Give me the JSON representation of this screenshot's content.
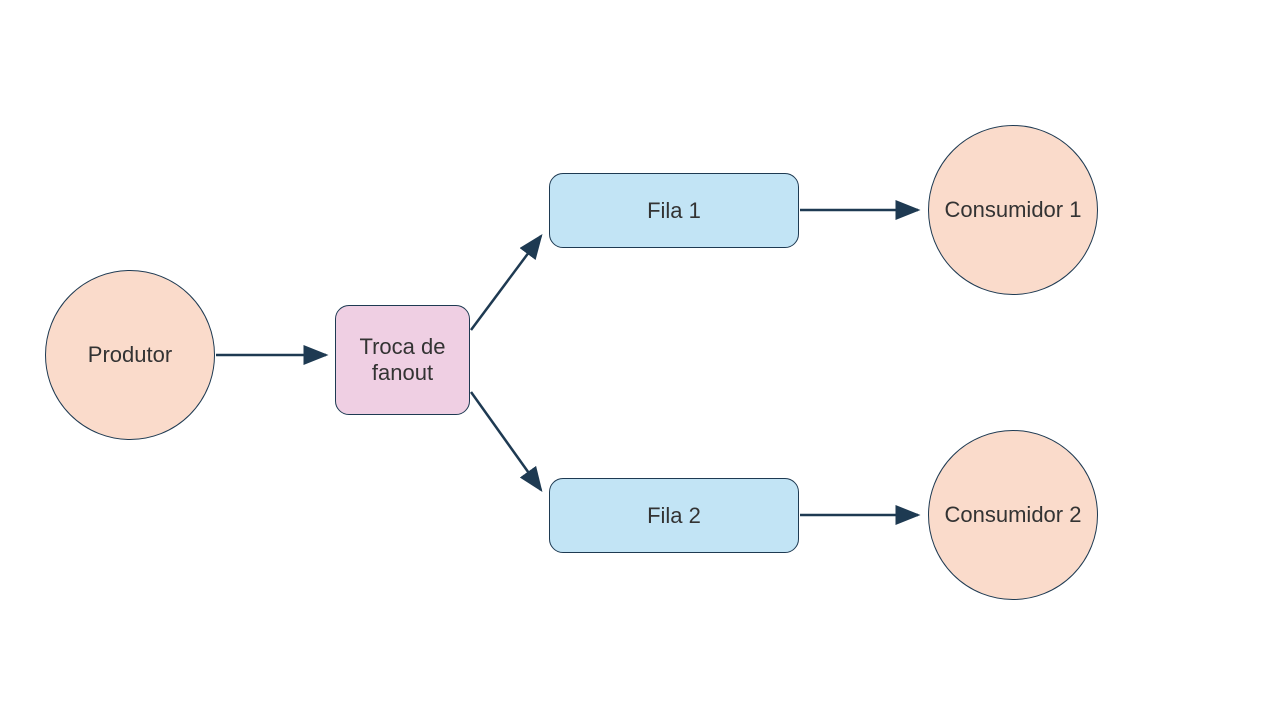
{
  "nodes": {
    "producer": {
      "label": "Produtor"
    },
    "exchange": {
      "label": "Troca de fanout"
    },
    "queue1": {
      "label": "Fila 1"
    },
    "queue2": {
      "label": "Fila 2"
    },
    "consumer1": {
      "label": "Consumidor 1"
    },
    "consumer2": {
      "label": "Consumidor 2"
    }
  },
  "colors": {
    "peach": "#fadbcb",
    "pink": "#efcfe3",
    "blue": "#c2e4f5",
    "stroke": "#1e3a52"
  }
}
